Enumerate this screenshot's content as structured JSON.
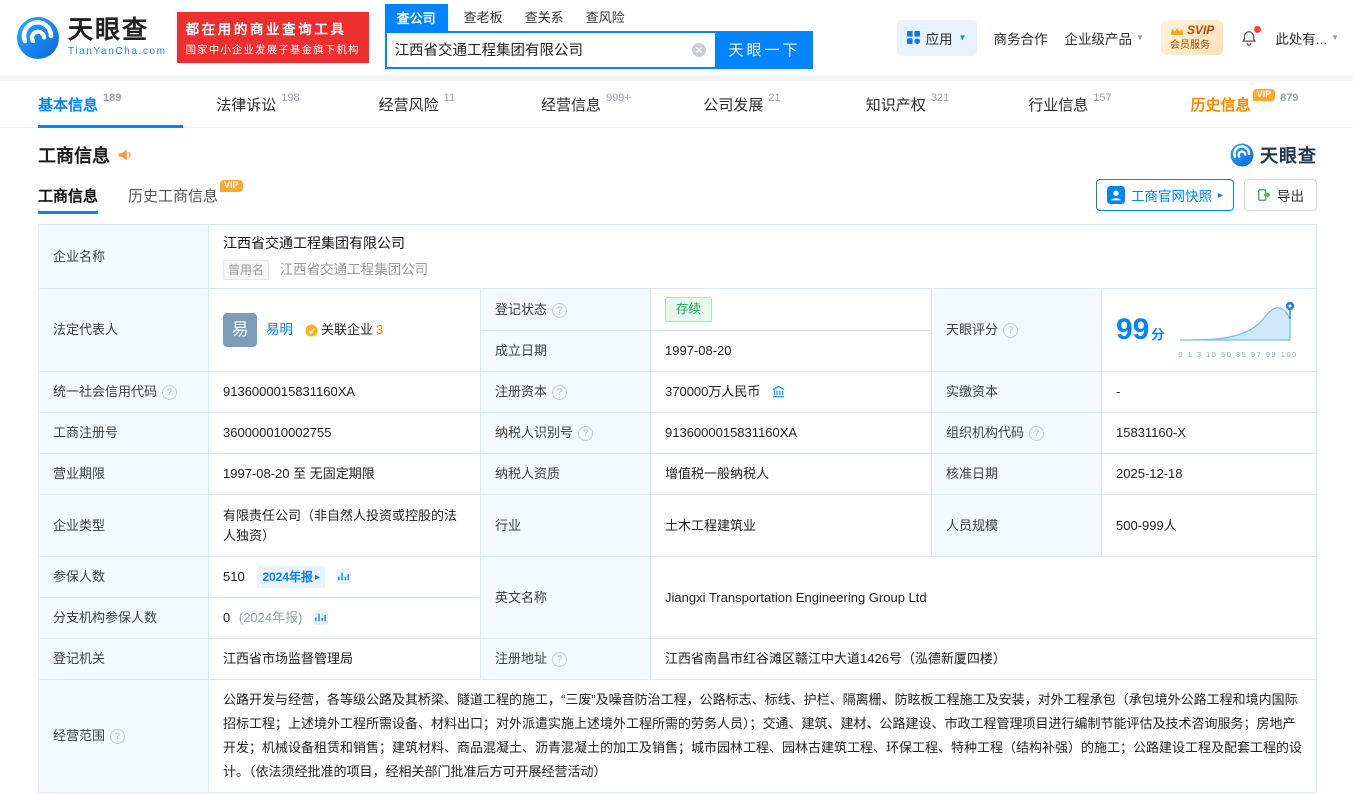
{
  "icons": {
    "caret": "▼",
    "arrow": "▸"
  },
  "colors": {
    "primary_blue": "#0084ff",
    "vip_orange": "#ff8a00",
    "status_green": "#0dab4e",
    "banner_red": "#ee2f2f"
  },
  "header": {
    "logo": {
      "brand": "天眼查",
      "domain": "TianYanCha.com"
    },
    "slogan": {
      "line1": "都在用的商业查询工具",
      "line2": "国家中小企业发展子基金旗下机构"
    },
    "search_tabs": [
      {
        "label": "查公司"
      },
      {
        "label": "查老板"
      },
      {
        "label": "查关系"
      },
      {
        "label": "查风险"
      }
    ],
    "search": {
      "value": "江西省交通工程集团有限公司",
      "button": "天眼一下"
    },
    "right": {
      "app": "应用",
      "cooperation": "商务合作",
      "enterprise": "企业级产品",
      "svip_line1": "SVIP",
      "svip_line2": "会员服务",
      "more": "此处有..."
    }
  },
  "nav_tabs": [
    {
      "label": "基本信息",
      "count": "189"
    },
    {
      "label": "法律诉讼",
      "count": "198"
    },
    {
      "label": "经营风险",
      "count": "11"
    },
    {
      "label": "经营信息",
      "count": "999+"
    },
    {
      "label": "公司发展",
      "count": "21"
    },
    {
      "label": "知识产权",
      "count": "321"
    },
    {
      "label": "行业信息",
      "count": "157"
    },
    {
      "label": "历史信息",
      "count": "879",
      "vip": "VIP"
    }
  ],
  "section": {
    "title": "工商信息",
    "brand_watermark": "天眼查",
    "subtabs": [
      {
        "label": "工商信息"
      },
      {
        "label": "历史工商信息",
        "vip": "VIP"
      }
    ],
    "snapshot_button": "工商官网快照",
    "export_button": "导出"
  },
  "info": {
    "company_name": {
      "label": "企业名称",
      "value": "江西省交通工程集团有限公司",
      "former_tag": "曾用名",
      "former_value": "江西省交通工程集团公司"
    },
    "legal_rep": {
      "label": "法定代表人",
      "avatar_char": "易",
      "name": "易明",
      "related_label": "关联企业",
      "related_count": "3"
    },
    "reg_status": {
      "label": "登记状态",
      "value": "存续"
    },
    "establish_date": {
      "label": "成立日期",
      "value": "1997-08-20"
    },
    "score": {
      "label": "天眼评分",
      "value": "99",
      "unit": "分",
      "axis_labels": "0 1 3 15 50 85 97 99 100"
    },
    "credit_code": {
      "label": "统一社会信用代码",
      "value": "9136000015831160XA"
    },
    "reg_capital": {
      "label": "注册资本",
      "value": "370000万人民币"
    },
    "paid_capital": {
      "label": "实缴资本",
      "value": "-"
    },
    "reg_number": {
      "label": "工商注册号",
      "value": "360000010002755"
    },
    "taxpayer_id": {
      "label": "纳税人识别号",
      "value": "9136000015831160XA"
    },
    "org_code": {
      "label": "组织机构代码",
      "value": "15831160-X"
    },
    "business_term": {
      "label": "营业期限",
      "value": "1997-08-20 至 无固定期限"
    },
    "taxpayer_quality": {
      "label": "纳税人资质",
      "value": "增值税一般纳税人"
    },
    "approval_date": {
      "label": "核准日期",
      "value": "2025-12-18"
    },
    "company_type": {
      "label": "企业类型",
      "value": "有限责任公司（非自然人投资或控股的法人独资）"
    },
    "industry": {
      "label": "行业",
      "value": "土木工程建筑业"
    },
    "staff_size": {
      "label": "人员规模",
      "value": "500-999人"
    },
    "insured_count": {
      "label": "参保人数",
      "value": "510",
      "report_badge": "2024年报"
    },
    "english_name": {
      "label": "英文名称",
      "value": "Jiangxi Transportation Engineering Group Ltd"
    },
    "branch_insured": {
      "label": "分支机构参保人数",
      "value": "0",
      "report_note": "(2024年报)"
    },
    "reg_authority": {
      "label": "登记机关",
      "value": "江西省市场监督管理局"
    },
    "reg_address": {
      "label": "注册地址",
      "value": "江西省南昌市红谷滩区赣江中大道1426号（泓德新厦四楼）"
    },
    "business_scope": {
      "label": "经营范围",
      "value": "公路开发与经营，各等级公路及其桥梁、隧道工程的施工，“三废”及噪音防治工程，公路标志、标线、护栏、隔离栅、防眩板工程施工及安装，对外工程承包（承包境外公路工程和境内国际招标工程；上述境外工程所需设备、材料出口；对外派遣实施上述境外工程所需的劳务人员）；交通、建筑、建材、公路建设、市政工程管理项目进行编制节能评估及技术咨询服务；房地产开发；机械设备租赁和销售；建筑材料、商品混凝土、沥青混凝土的加工及销售；城市园林工程、园林古建筑工程、环保工程、特种工程（结构补强）的施工；公路建设工程及配套工程的设计。（依法须经批准的项目，经相关部门批准后方可开展经营活动）"
    }
  }
}
